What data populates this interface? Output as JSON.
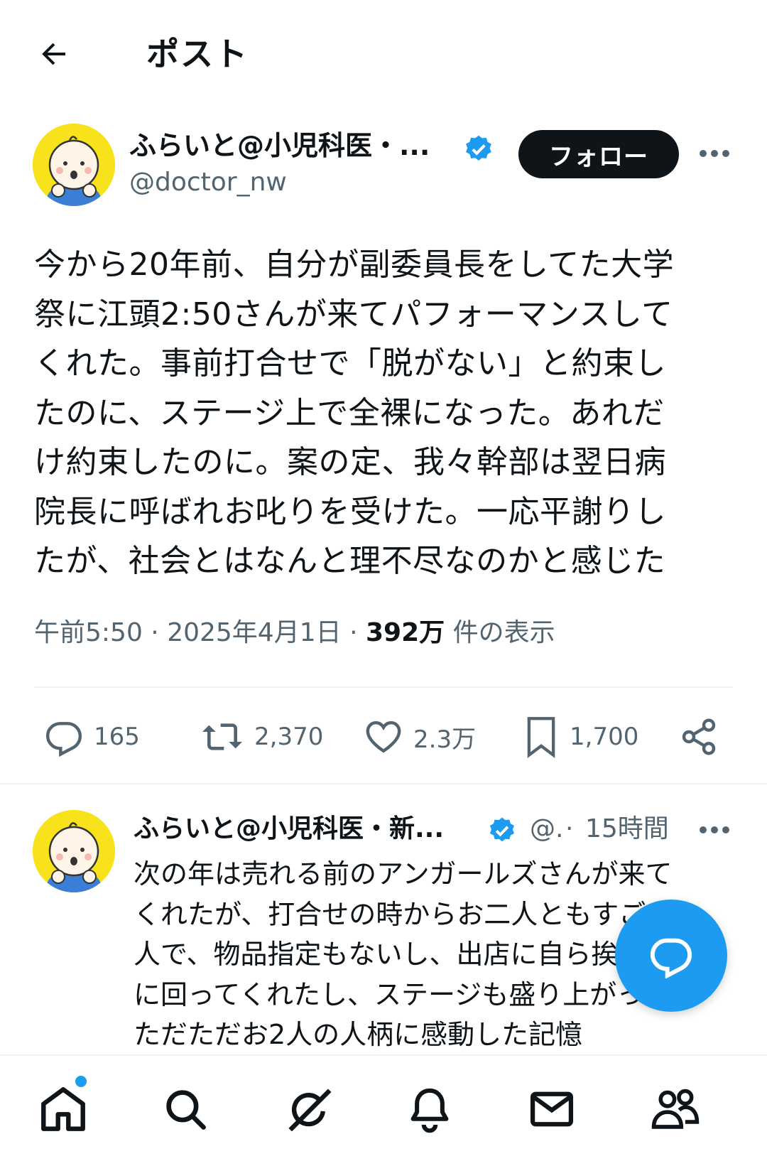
{
  "header": {
    "title": "ポスト"
  },
  "tweet": {
    "display_name": "ふらいと@小児科医・...",
    "handle": "@doctor_nw",
    "follow_label": "フォロー",
    "text": "今から20年前、自分が副委員長をしてた大学\n祭に江頭2:50さんが来てパフォーマンスして\nくれた。事前打合せで「脱がない」と約束し\nたのに、ステージ上で全裸になった。あれだ\nけ約束したのに。案の定、我々幹部は翌日病\n院長に呼ばれお叱りを受けた。一応平謝りし\nたが、社会とはなんと理不尽なのかと感じた",
    "time": "午前5:50",
    "date": "2025年4月1日",
    "views_count": "392万",
    "views_label": "件の表示",
    "stats": {
      "replies": "165",
      "reposts": "2,370",
      "likes": "2.3万",
      "bookmarks": "1,700"
    }
  },
  "reply": {
    "display_name": "ふらいと@小児科医・新...",
    "handle": "@.",
    "time": "15時間",
    "text": "次の年は売れる前のアンガールズさんが来て\nくれたが、打合せの時からお二人ともすごい\n人で、物品指定もないし、出店に自ら挨拶\nに回ってくれたし、ステージも盛り上がった。\nただただお2人の人柄に感動した記憶"
  },
  "colors": {
    "accent": "#1d9bf0",
    "text": "#0f1419",
    "secondary": "#536471",
    "verified": "#1d9bf0",
    "avatar_bg": "#f7e21b"
  },
  "icons": [
    "back-arrow-icon",
    "verified-badge-icon",
    "more-icon",
    "reply-icon",
    "repost-icon",
    "like-icon",
    "bookmark-icon",
    "share-icon",
    "compose-reply-icon",
    "home-icon",
    "search-icon",
    "grok-icon",
    "notifications-icon",
    "messages-icon",
    "communities-icon"
  ]
}
